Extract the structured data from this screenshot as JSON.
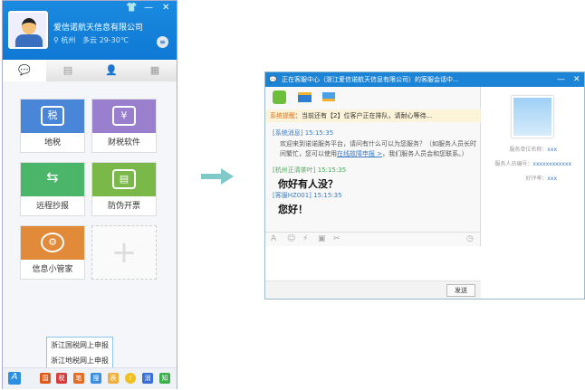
{
  "left_panel": {
    "company": "爱信诺航天信息有限公司",
    "location": "杭州",
    "weather": "多云 29-30℃",
    "window_controls": [
      "skin",
      "minimize",
      "close"
    ],
    "tabs": [
      "chat",
      "news",
      "contacts",
      "apps"
    ],
    "tiles": [
      {
        "label": "地税",
        "color": "#4a86d8"
      },
      {
        "label": "财税软件",
        "color": "#9b7fcf"
      },
      {
        "label": "远程抄报",
        "color": "#4bb56a"
      },
      {
        "label": "防伪开票",
        "color": "#7ab849"
      },
      {
        "label": "信息小管家",
        "color": "#e08a3a"
      }
    ],
    "tooltip": [
      "浙江国税网上申报",
      "浙江地税网上申报"
    ],
    "bottom_icons": [
      "国",
      "税",
      "笔",
      "搜",
      "表",
      "!",
      "消",
      "知"
    ]
  },
  "chat_window": {
    "title": "正在客服中心（浙江爱信诺航天信息有限公司）的客服会话中...",
    "notice_label": "系统提醒",
    "notice_text": "：当前还有【2】位客户正在排队，请耐心等待...",
    "messages": [
      {
        "sender": "[系统消息]",
        "time": "15:15:35",
        "text": "欢迎来到诺诺服务平台，请问有什么可以为您服务？（如服务人员长时间繁忙，您可以使用",
        "link": "在线故障申报 >",
        "text2": "，我们服务人员会和您联系。）"
      },
      {
        "sender": "[杭州正清茶叶]",
        "time": "15:15:35",
        "text": "你好有人没？"
      },
      {
        "sender": "[客服HZ001]",
        "time": "15:15:35",
        "text": "您好！"
      }
    ],
    "send_label": "发送",
    "info": [
      {
        "label": "服务单位名称：",
        "value": "xxx"
      },
      {
        "label": "服务人员编号：",
        "value": "xxxxxxxxxxxx"
      },
      {
        "label": "好评率：",
        "value": "xxx"
      }
    ]
  }
}
